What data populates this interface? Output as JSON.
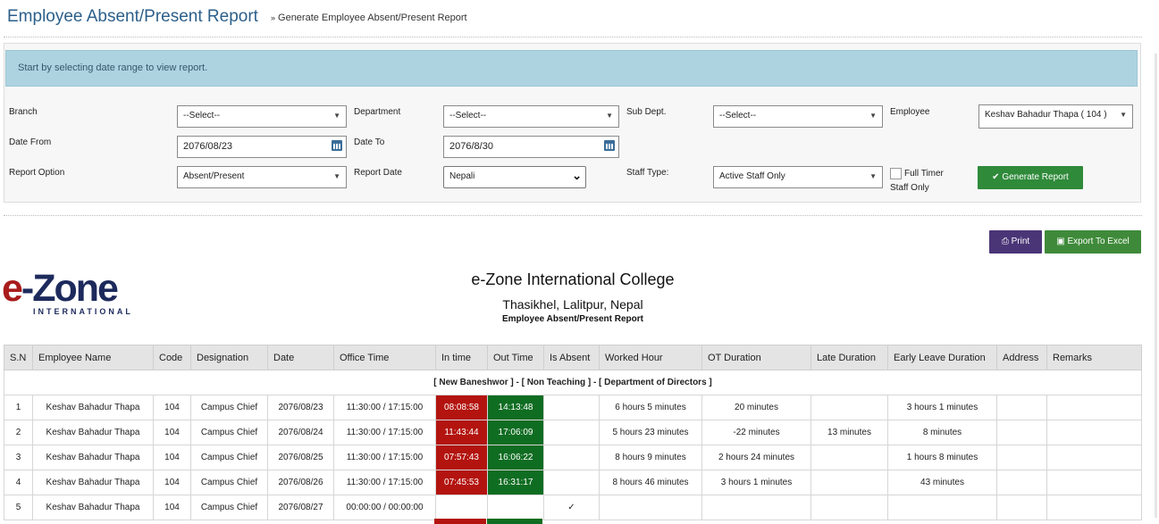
{
  "header": {
    "title": "Employee Absent/Present Report",
    "breadcrumb_arrow": "»",
    "breadcrumb": "Generate Employee Absent/Present Report"
  },
  "alert": {
    "text": "Start by selecting date range to view report."
  },
  "filters": {
    "branch_label": "Branch",
    "branch_value": "--Select--",
    "department_label": "Department",
    "department_value": "--Select--",
    "subdept_label": "Sub Dept.",
    "subdept_value": "--Select--",
    "employee_label": "Employee",
    "employee_value": "Keshav Bahadur Thapa ( 104 )",
    "date_from_label": "Date From",
    "date_from_value": "2076/08/23",
    "date_to_label": "Date To",
    "date_to_value": "2076/8/30",
    "report_option_label": "Report Option",
    "report_option_value": "Absent/Present",
    "report_date_label": "Report Date",
    "report_date_value": "Nepali",
    "staff_type_label": "Staff Type:",
    "staff_type_value": "Active Staff Only",
    "full_timer_label": "Full Timer",
    "staff_only_label": "Staff Only",
    "full_timer_checked": false
  },
  "buttons": {
    "generate": "Generate Report",
    "print": "Print",
    "export": "Export To Excel"
  },
  "logo": {
    "e": "e",
    "zone": "-Zone",
    "sub": "INTERNATIONAL"
  },
  "org": {
    "name": "e-Zone International College",
    "address": "Thasikhel, Lalitpur, Nepal",
    "report_title": "Employee Absent/Present Report"
  },
  "table": {
    "columns": [
      "S.N",
      "Employee Name",
      "Code",
      "Designation",
      "Date",
      "Office Time",
      "In time",
      "Out Time",
      "Is Absent",
      "Worked Hour",
      "OT Duration",
      "Late Duration",
      "Early Leave Duration",
      "Address",
      "Remarks"
    ],
    "group_label": "[ New Baneshwor ] - [ Non Teaching ] - [ Department of Directors ]",
    "rows": [
      {
        "sn": "1",
        "name": "Keshav Bahadur Thapa",
        "code": "104",
        "designation": "Campus Chief",
        "date": "2076/08/23",
        "office_time": "11:30:00 / 17:15:00",
        "in_time": "08:08:58",
        "out_time": "14:13:48",
        "is_absent": "",
        "worked": "6 hours 5 minutes",
        "ot": "20 minutes",
        "late": "",
        "early": "3 hours 1 minutes",
        "address": "",
        "remarks": ""
      },
      {
        "sn": "2",
        "name": "Keshav Bahadur Thapa",
        "code": "104",
        "designation": "Campus Chief",
        "date": "2076/08/24",
        "office_time": "11:30:00 / 17:15:00",
        "in_time": "11:43:44",
        "out_time": "17:06:09",
        "is_absent": "",
        "worked": "5 hours 23 minutes",
        "ot": "-22 minutes",
        "late": "13 minutes",
        "early": "8 minutes",
        "address": "",
        "remarks": ""
      },
      {
        "sn": "3",
        "name": "Keshav Bahadur Thapa",
        "code": "104",
        "designation": "Campus Chief",
        "date": "2076/08/25",
        "office_time": "11:30:00 / 17:15:00",
        "in_time": "07:57:43",
        "out_time": "16:06:22",
        "is_absent": "",
        "worked": "8 hours 9 minutes",
        "ot": "2 hours 24 minutes",
        "late": "",
        "early": "1 hours 8 minutes",
        "address": "",
        "remarks": ""
      },
      {
        "sn": "4",
        "name": "Keshav Bahadur Thapa",
        "code": "104",
        "designation": "Campus Chief",
        "date": "2076/08/26",
        "office_time": "11:30:00 / 17:15:00",
        "in_time": "07:45:53",
        "out_time": "16:31:17",
        "is_absent": "",
        "worked": "8 hours 46 minutes",
        "ot": "3 hours 1 minutes",
        "late": "",
        "early": "43 minutes",
        "address": "",
        "remarks": ""
      },
      {
        "sn": "5",
        "name": "Keshav Bahadur Thapa",
        "code": "104",
        "designation": "Campus Chief",
        "date": "2076/08/27",
        "office_time": "00:00:00 / 00:00:00",
        "in_time": "",
        "out_time": "",
        "is_absent": "✓",
        "worked": "",
        "ot": "",
        "late": "",
        "early": "",
        "address": "",
        "remarks": ""
      }
    ]
  },
  "colors": {
    "title": "#2c5f8a",
    "in_time_bg": "#b3140f",
    "out_time_bg": "#0f6d22",
    "alert_bg": "#aed3e0",
    "generate_btn": "#2f8a3a",
    "print_btn": "#4a3577"
  }
}
